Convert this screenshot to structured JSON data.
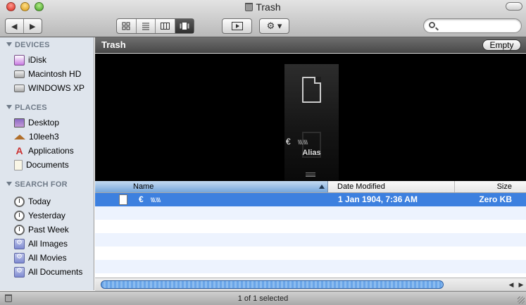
{
  "window": {
    "title": "Trash"
  },
  "toolbar": {
    "back_label": "◀",
    "forward_label": "▶",
    "quicklook_label": "▶",
    "action_label": "⚙ ▾",
    "search_placeholder": "",
    "view_modes": [
      "icons",
      "list",
      "columns",
      "coverflow"
    ],
    "active_view": "coverflow"
  },
  "sidebar": {
    "devices_header": "DEVICES",
    "devices": [
      "iDisk",
      "Macintosh HD",
      "WINDOWS XP"
    ],
    "places_header": "PLACES",
    "places": [
      "Desktop",
      "10leeh3",
      "Applications",
      "Documents"
    ],
    "search_header": "SEARCH FOR",
    "search_items": [
      "Today",
      "Yesterday",
      "Past Week",
      "All Images",
      "All Movies",
      "All Documents"
    ]
  },
  "main": {
    "path_title": "Trash",
    "empty_button": "Empty"
  },
  "coverflow": {
    "name_glyph": "€",
    "name_rest": "\\\\\\\\.\\\\\\\\",
    "kind": "Alias"
  },
  "list": {
    "columns": {
      "name": "Name",
      "date": "Date Modified",
      "size": "Size"
    },
    "sort_column": "name",
    "rows": [
      {
        "name_glyph": "€",
        "name_rest": "\\\\\\\\.\\\\\\\\",
        "date": "1 Jan 1904, 7:36 AM",
        "size": "Zero KB",
        "selected": true
      }
    ]
  },
  "status": {
    "text": "1 of 1 selected"
  },
  "colors": {
    "selection": "#3d80df",
    "sidebar": "#dfe5ed",
    "coverflow_bg": "#000000"
  }
}
